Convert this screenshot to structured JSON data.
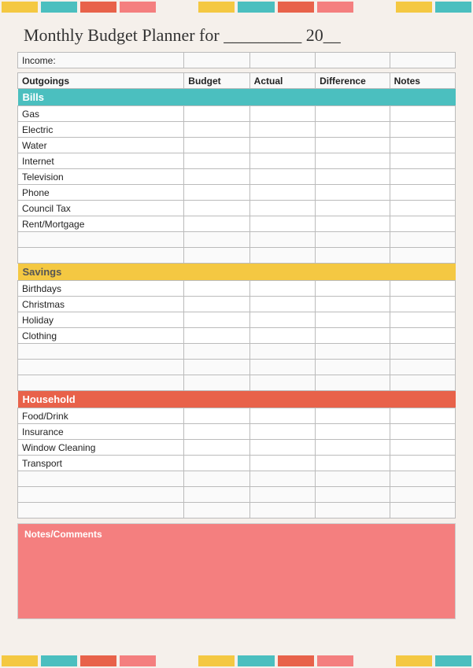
{
  "title": "Monthly Budget Planner for _________ 20__",
  "topBar": [
    "yellow",
    "teal",
    "coral",
    "pink",
    "white",
    "yellow",
    "teal",
    "coral",
    "pink",
    "white",
    "yellow",
    "teal"
  ],
  "bottomBar": [
    "yellow",
    "teal",
    "coral",
    "pink",
    "white",
    "yellow",
    "teal",
    "coral",
    "pink",
    "white",
    "yellow",
    "teal"
  ],
  "table": {
    "incomeLabel": "Income:",
    "headers": {
      "outgoings": "Outgoings",
      "budget": "Budget",
      "actual": "Actual",
      "difference": "Difference",
      "notes": "Notes"
    },
    "sections": {
      "bills": {
        "label": "Bills",
        "items": [
          "Gas",
          "Electric",
          "Water",
          "Internet",
          "Television",
          "Phone",
          "Council Tax",
          "Rent/Mortgage"
        ]
      },
      "savings": {
        "label": "Savings",
        "items": [
          "Birthdays",
          "Christmas",
          "Holiday",
          "Clothing"
        ]
      },
      "household": {
        "label": "Household",
        "items": [
          "Food/Drink",
          "Insurance",
          "Window Cleaning",
          "Transport"
        ]
      }
    }
  },
  "notes": {
    "label": "Notes/Comments"
  }
}
